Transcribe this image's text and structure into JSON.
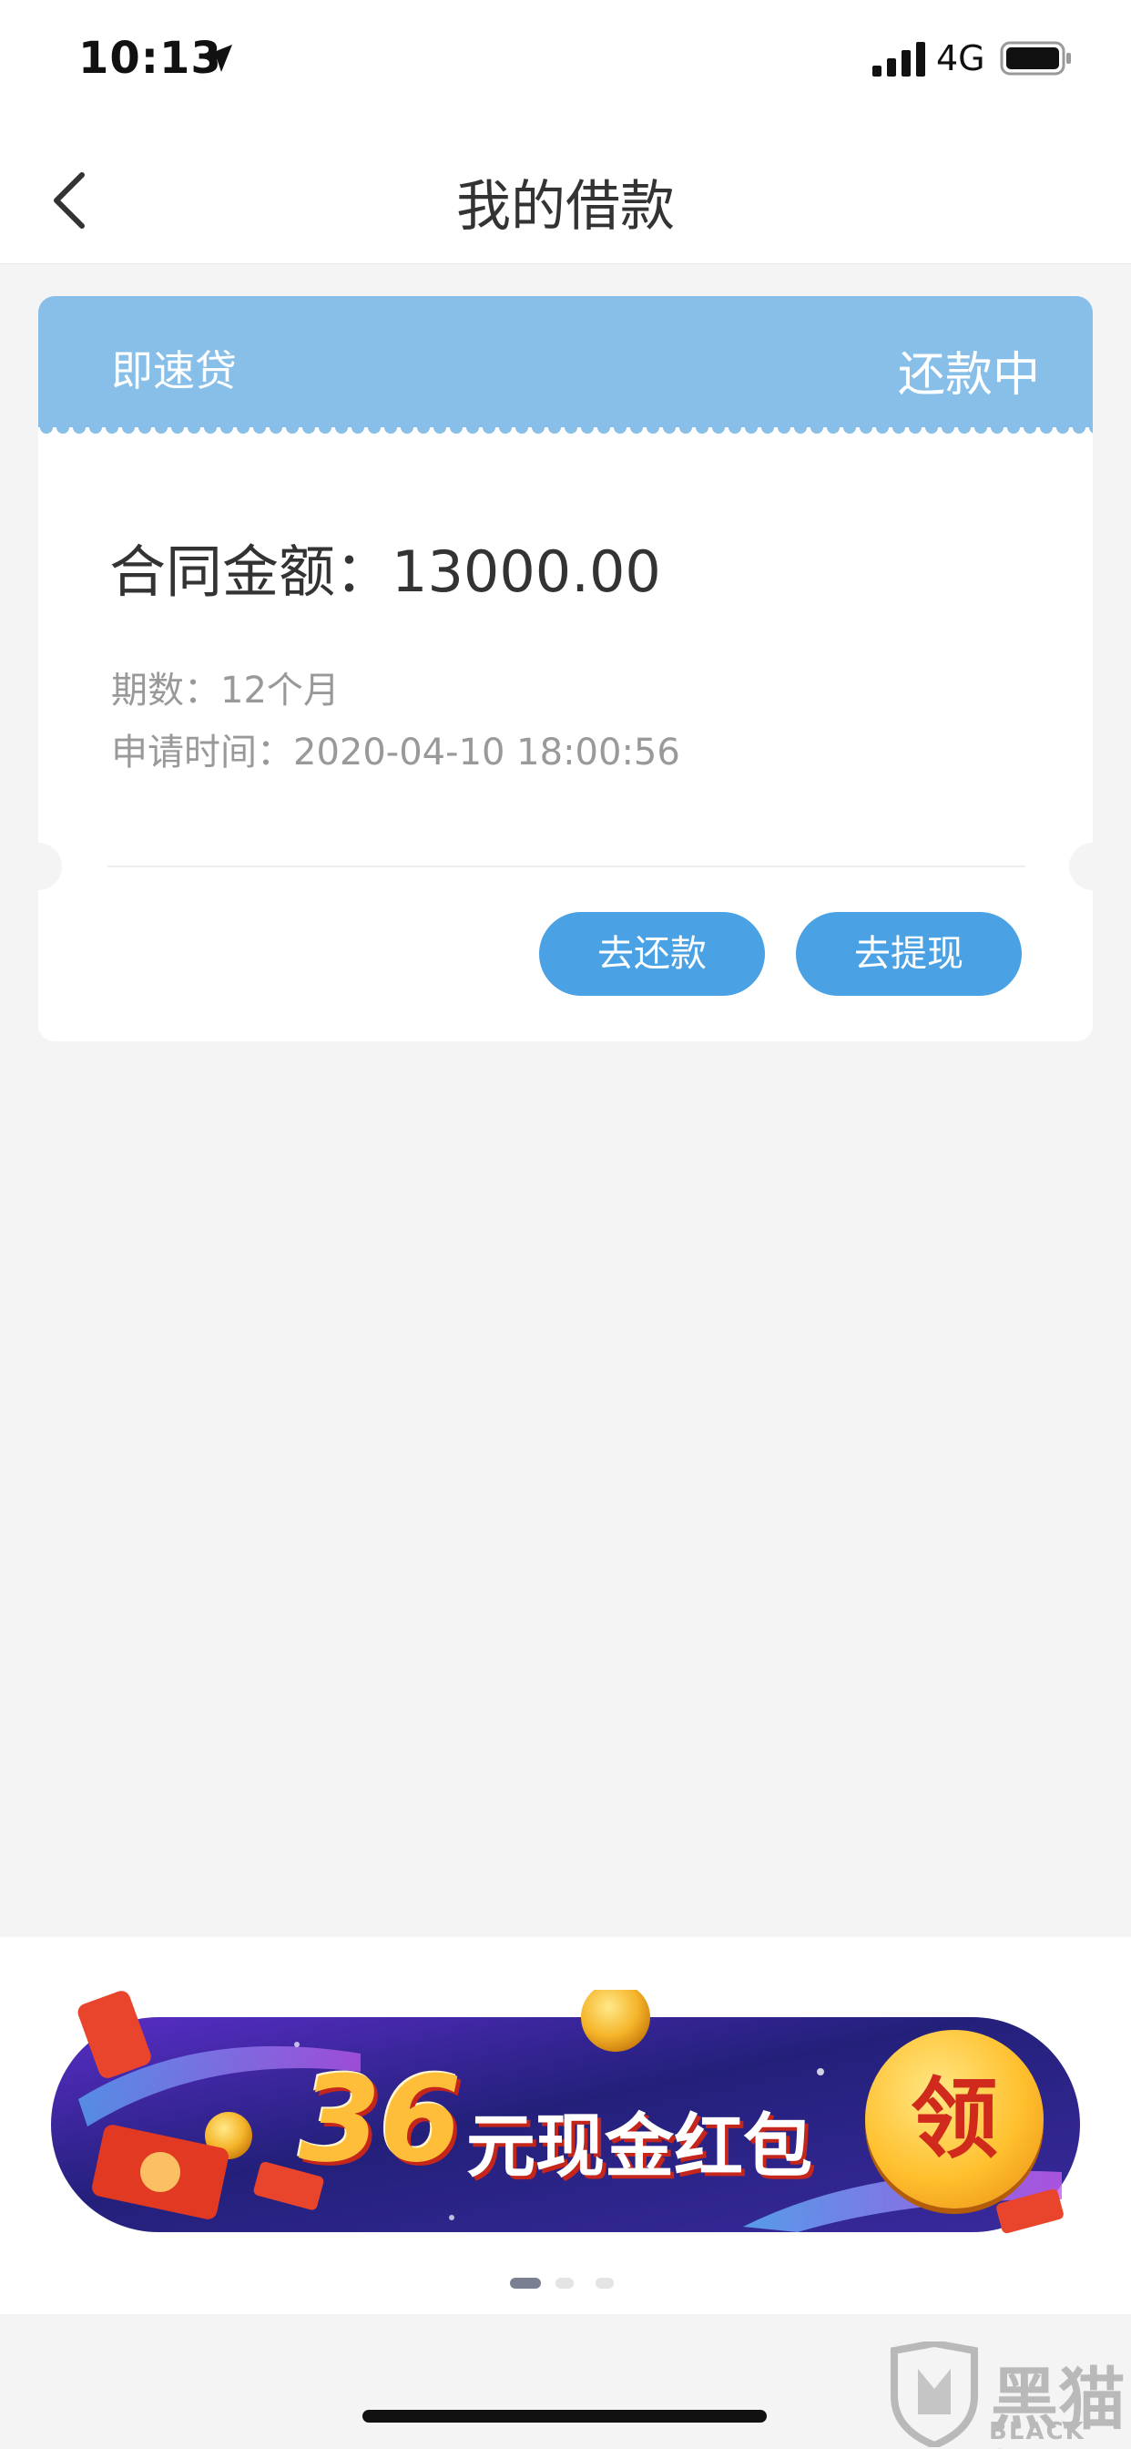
{
  "status_bar": {
    "time": "10:13",
    "network": "4G",
    "icons": [
      "location-arrow-icon",
      "signal-bars-icon",
      "battery-icon"
    ]
  },
  "nav": {
    "title": "我的借款",
    "back_icon": "chevron-left-icon"
  },
  "loan_card": {
    "product": "即速贷",
    "status": "还款中",
    "amount_label": "合同金额：",
    "amount_value": "13000.00",
    "terms_label": "期数：",
    "terms_value": "12个月",
    "apply_time_label": "申请时间：",
    "apply_time_value": "2020-04-10 18:00:56",
    "repay_button": "去还款",
    "withdraw_button": "去提现",
    "header_color": "#88bfe9",
    "button_color": "#4aa1e4"
  },
  "banner": {
    "amount": "36",
    "caption": "元现金红包",
    "claim": "领",
    "carousel": {
      "count": 3,
      "active_index": 0
    }
  },
  "watermark": {
    "name_cn": "黑猫",
    "name_en": "BLACK CAT"
  }
}
